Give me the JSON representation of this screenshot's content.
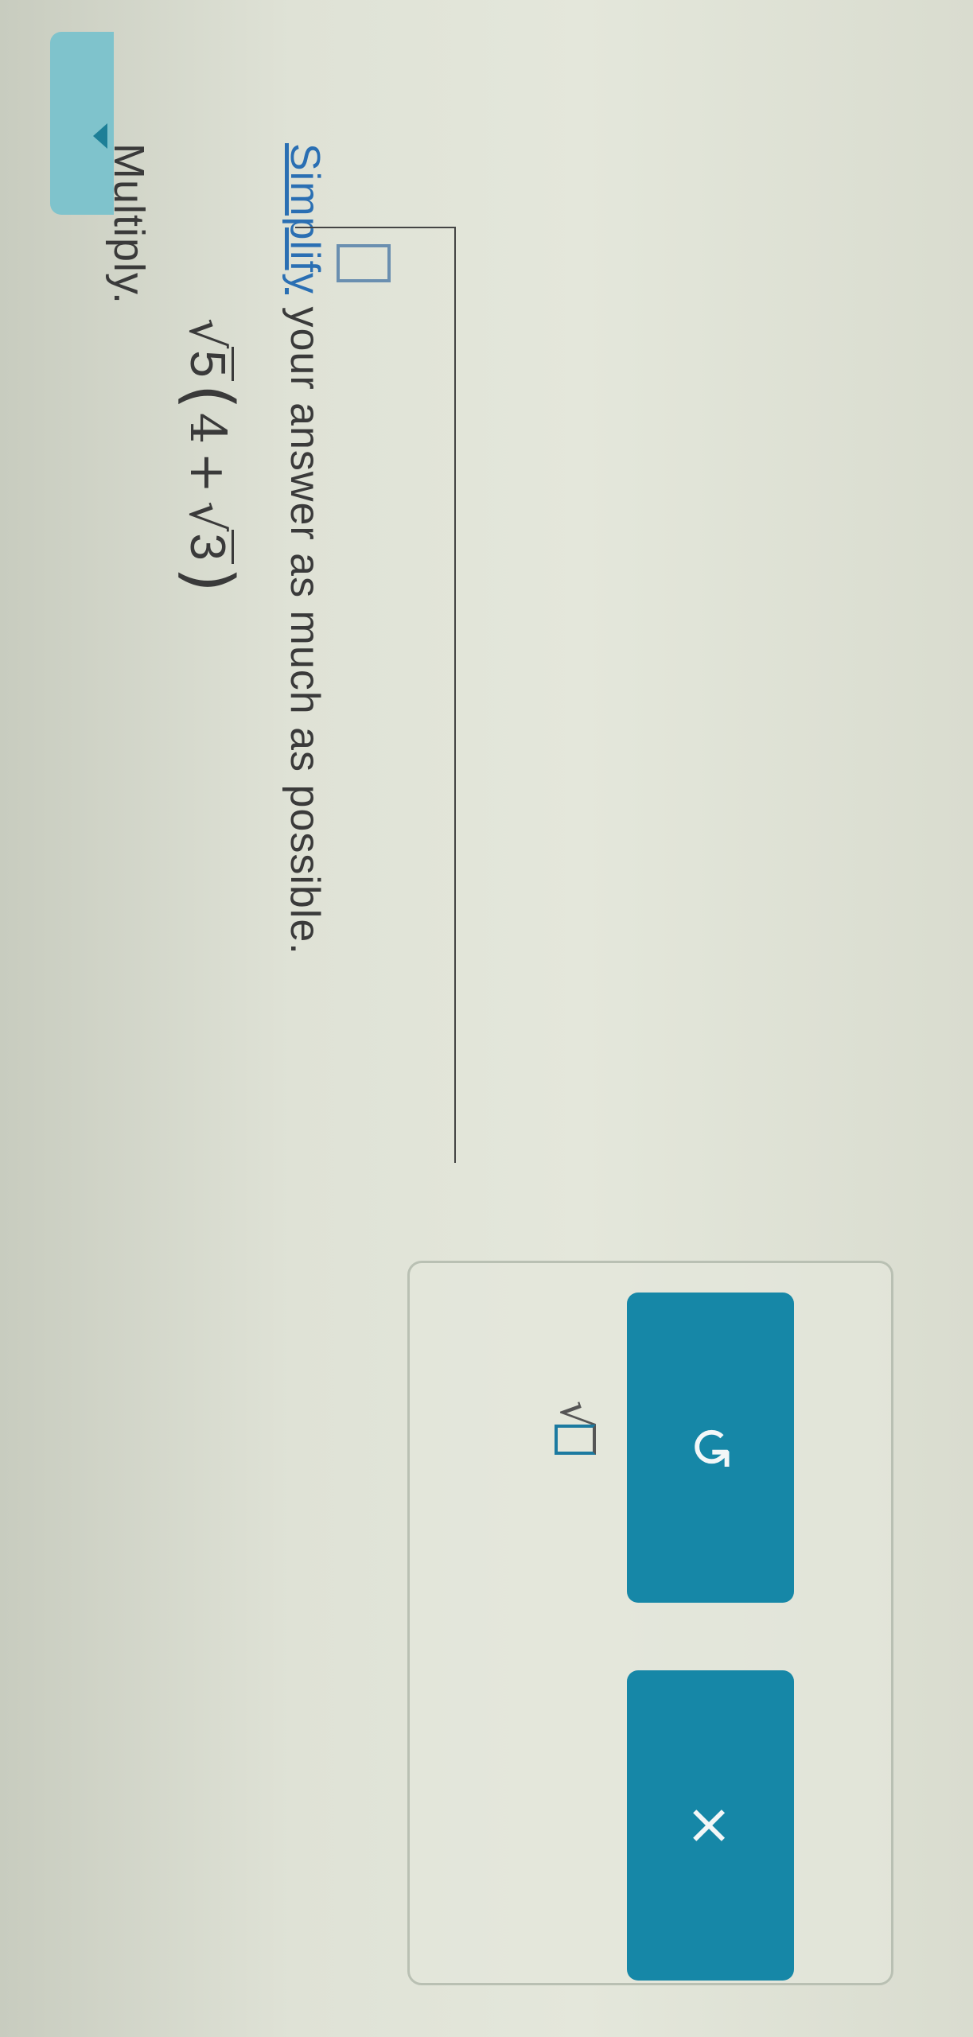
{
  "header": {
    "tab_arrow": "chevron-down-icon"
  },
  "question": {
    "title": "Multiply.",
    "expression": {
      "outer_radicand": "5",
      "open_paren": "(",
      "term1": "4",
      "operator": "+",
      "inner_radicand": "3",
      "close_paren": ")"
    },
    "instruction": {
      "link_text": "Simplify",
      "rest": " your answer as much as possible."
    }
  },
  "answer": {
    "value": ""
  },
  "toolbar": {
    "sqrt_button_icon": "square-root-icon",
    "undo_glyph": "↺",
    "clear_glyph": "×"
  },
  "colors": {
    "accent": "#1687a7",
    "link": "#2a6fb3",
    "tab": "#7fc3cc"
  }
}
